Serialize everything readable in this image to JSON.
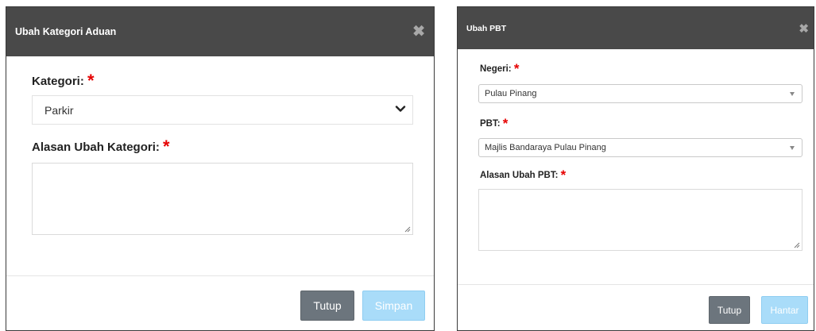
{
  "kategori_modal": {
    "title": "Ubah Kategori Aduan",
    "close_icon": "close-icon",
    "kategori_label": "Kategori:",
    "required_mark": "*",
    "kategori_value": "Parkir",
    "alasan_label": "Alasan Ubah Kategori:",
    "alasan_value": "",
    "tutup_label": "Tutup",
    "simpan_label": "Simpan"
  },
  "pbt_modal": {
    "title": "Ubah PBT",
    "close_icon": "close-icon",
    "negeri_label": "Negeri:",
    "negeri_value": "Pulau Pinang",
    "pbt_label": "PBT:",
    "pbt_value": "Majlis Bandaraya Pulau Pinang",
    "alasan_label": "Alasan Ubah PBT:",
    "alasan_value": "",
    "required_mark": "*",
    "tutup_label": "Tutup",
    "hantar_label": "Hantar"
  },
  "colors": {
    "header_bg": "#494949",
    "required": "#e60000",
    "btn_secondary": "#6c757d",
    "btn_primary_disabled": "#a9dcf9"
  }
}
